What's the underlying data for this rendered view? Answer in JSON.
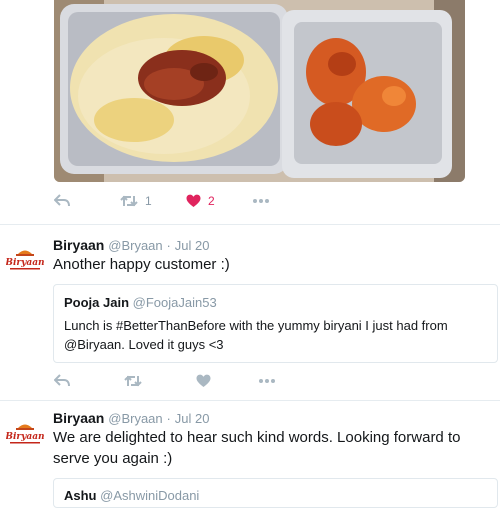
{
  "photo": {
    "alt": "food-photo"
  },
  "tweet1_actions": {
    "retweets": "1",
    "likes": "2"
  },
  "tweet2": {
    "name": "Biryaan",
    "handle": "@Bryaan",
    "date": "Jul 20",
    "text": "Another happy customer :)",
    "quote": {
      "name": "Pooja Jain",
      "handle": "@FoojaJain53",
      "text": "Lunch is #BetterThanBefore with the yummy biryani I just had from @Biryaan. Loved it guys <3"
    }
  },
  "tweet3": {
    "name": "Biryaan",
    "handle": "@Bryaan",
    "date": "Jul 20",
    "text": "We are delighted to hear such kind words. Looking forward to serve you again :)",
    "quote": {
      "name": "Ashu",
      "handle": "@AshwiniDodani"
    }
  },
  "avatar": {
    "logo_text": "Biryaan"
  },
  "colors": {
    "like": "#e0245e",
    "icon": "#aab8c2",
    "meta": "#8899a6",
    "divider": "#e6ecf0"
  },
  "icons": [
    "reply-icon",
    "retweet-icon",
    "heart-icon",
    "more-icon"
  ]
}
